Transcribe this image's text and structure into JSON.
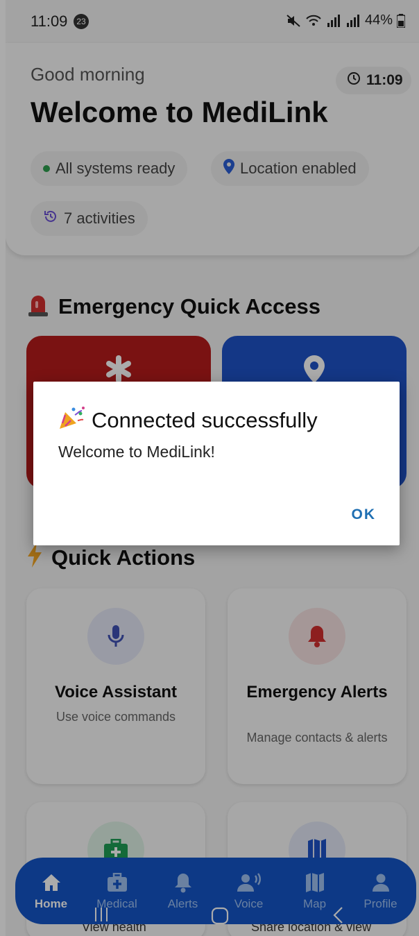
{
  "status_bar": {
    "time": "11:09",
    "notification_count": "23",
    "battery": "44%"
  },
  "header": {
    "greeting": "Good morning",
    "clock": "11:09",
    "title": "Welcome to MediLink",
    "chips": {
      "status": "All systems ready",
      "location": "Location enabled",
      "activities": "7 activities"
    }
  },
  "emergency": {
    "heading": "Emergency Quick Access"
  },
  "quick_actions": {
    "heading": "Quick Actions",
    "cards": {
      "voice": {
        "title": "Voice Assistant",
        "subtitle": "Use voice commands"
      },
      "alerts": {
        "title": "Emergency Alerts",
        "subtitle": "Manage contacts & alerts"
      },
      "medical_sub": "View health",
      "map_sub": "Share location & view"
    }
  },
  "bottom_nav": {
    "home": "Home",
    "medical": "Medical",
    "alerts": "Alerts",
    "voice": "Voice",
    "map": "Map",
    "profile": "Profile"
  },
  "dialog": {
    "title": "Connected successfully",
    "message": "Welcome to MediLink!",
    "ok": "OK"
  },
  "colors": {
    "emergency_red": "#b71c1c",
    "map_blue": "#1e52c8",
    "nav_blue": "#1456c8",
    "ok_blue": "#1f6fb2"
  }
}
